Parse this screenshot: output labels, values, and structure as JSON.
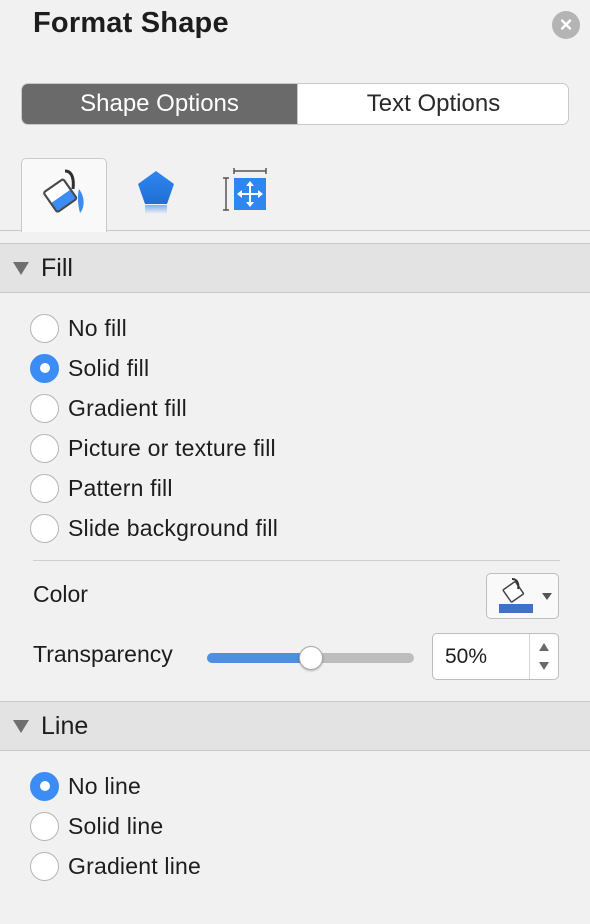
{
  "panel": {
    "title": "Format Shape",
    "close_icon": "close-icon"
  },
  "option_tabs": [
    {
      "label": "Shape Options",
      "active": true
    },
    {
      "label": "Text Options",
      "active": false
    }
  ],
  "icon_tabs": [
    {
      "icon": "fill-bucket-icon",
      "active": true
    },
    {
      "icon": "pentagon-effects-icon",
      "active": false
    },
    {
      "icon": "size-position-icon",
      "active": false
    }
  ],
  "fill": {
    "header": "Fill",
    "options": [
      {
        "label": "No fill",
        "checked": false
      },
      {
        "label": "Solid fill",
        "checked": true
      },
      {
        "label": "Gradient fill",
        "checked": false
      },
      {
        "label": "Picture or texture fill",
        "checked": false
      },
      {
        "label": "Pattern fill",
        "checked": false
      },
      {
        "label": "Slide background fill",
        "checked": false
      }
    ],
    "color_label": "Color",
    "color_value": "#4472C4",
    "transparency_label": "Transparency",
    "transparency_value": "50%",
    "transparency_fraction": 0.5
  },
  "line": {
    "header": "Line",
    "options": [
      {
        "label": "No line",
        "checked": true
      },
      {
        "label": "Solid line",
        "checked": false
      },
      {
        "label": "Gradient line",
        "checked": false
      }
    ]
  },
  "colors": {
    "accent": "#3B8CF5",
    "active_tab": "#6A6A6A"
  }
}
